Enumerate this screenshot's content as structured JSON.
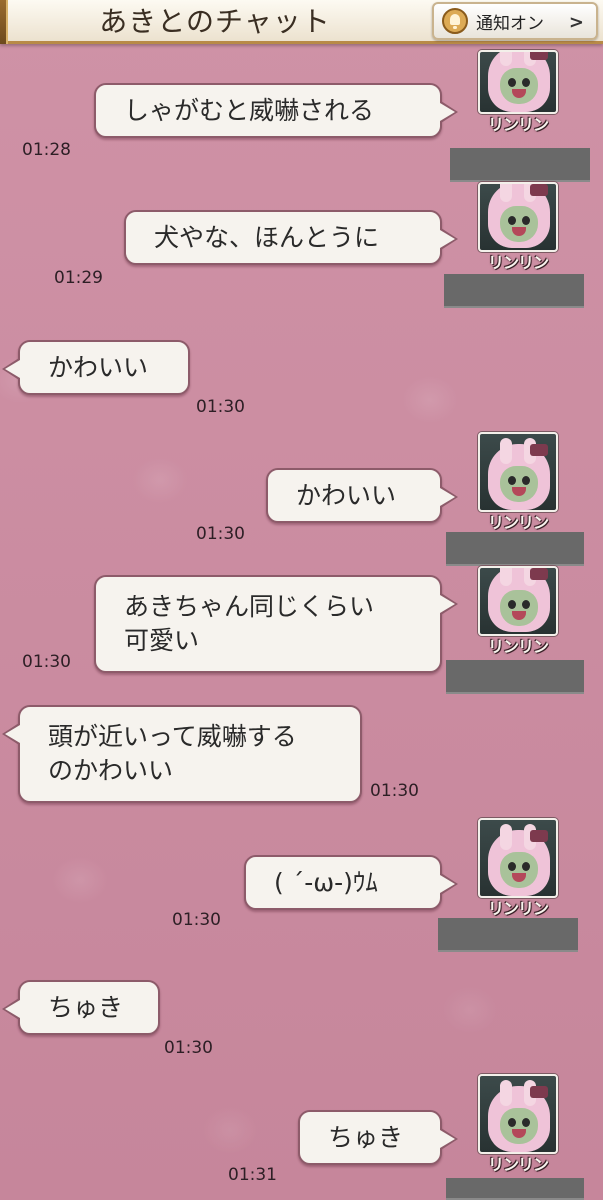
{
  "header": {
    "title": "あきとのチャット",
    "notify_label": "通知オン"
  },
  "messages": [
    {
      "side": "right",
      "text": "しゃがむと威嚇される",
      "time": "01:28",
      "sender": "リンリン"
    },
    {
      "side": "right",
      "text": "犬やな、ほんとうに",
      "time": "01:29",
      "sender": "リンリン"
    },
    {
      "side": "left",
      "text": "かわいい",
      "time": "01:30"
    },
    {
      "side": "right",
      "text": "かわいい",
      "time": "01:30",
      "sender": "リンリン"
    },
    {
      "side": "right",
      "text": "あきちゃん同じくらい\n可愛い",
      "time": "01:30",
      "sender": "リンリン"
    },
    {
      "side": "left",
      "text": "頭が近いって威嚇する\nのかわいい",
      "time": "01:30"
    },
    {
      "side": "right",
      "text": "( ´-ω-)ｳﾑ",
      "time": "01:30",
      "sender": "リンリン"
    },
    {
      "side": "left",
      "text": "ちゅき",
      "time": "01:30"
    },
    {
      "side": "right",
      "text": "ちゅき",
      "time": "01:31",
      "sender": "リンリン"
    }
  ],
  "colors": {
    "background": "#c98a9e",
    "bubble": "#f6f3ee",
    "bubble_border": "#8d5b6a",
    "header_border": "#b88a47"
  }
}
